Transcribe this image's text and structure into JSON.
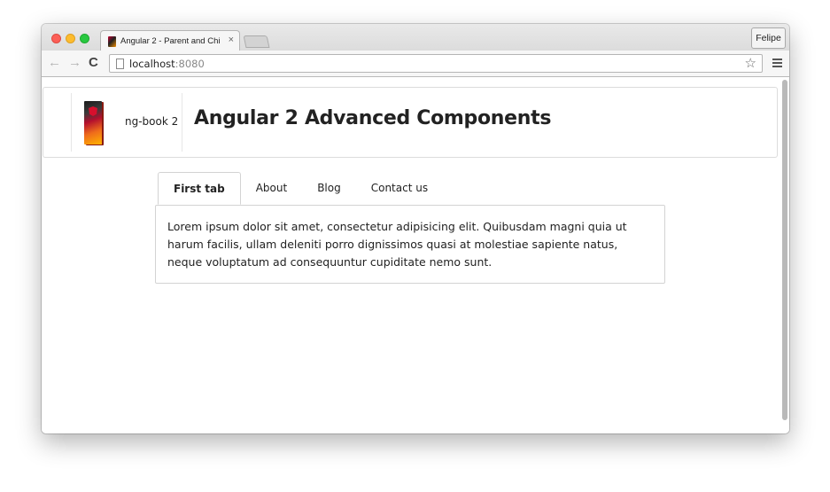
{
  "browser": {
    "tab_title": "Angular 2 - Parent and Chi",
    "tab_close": "×",
    "profile_label": "Felipe",
    "url_host": "localhost",
    "url_port": ":8080",
    "icons": {
      "back": "arrow-left",
      "forward": "arrow-right",
      "reload": "reload",
      "bookmark": "star-outline",
      "menu": "hamburger"
    },
    "glyphs": {
      "back": "←",
      "forward": "→",
      "reload": "C",
      "star": "☆"
    },
    "traffic_light_colors": [
      "#fc5f57",
      "#fdbc2e",
      "#28c840"
    ]
  },
  "header": {
    "brand_name": "ng-book 2",
    "title": "Angular 2 Advanced Components"
  },
  "tabs": [
    {
      "label": "First tab",
      "active": true
    },
    {
      "label": "About",
      "active": false
    },
    {
      "label": "Blog",
      "active": false
    },
    {
      "label": "Contact us",
      "active": false
    }
  ],
  "content": {
    "text": "Lorem ipsum dolor sit amet, consectetur adipisicing elit. Quibusdam magni quia ut harum facilis, ullam deleniti porro dignissimos quasi at molestiae sapiente natus, neque voluptatum ad consequuntur cupiditate nemo sunt."
  }
}
